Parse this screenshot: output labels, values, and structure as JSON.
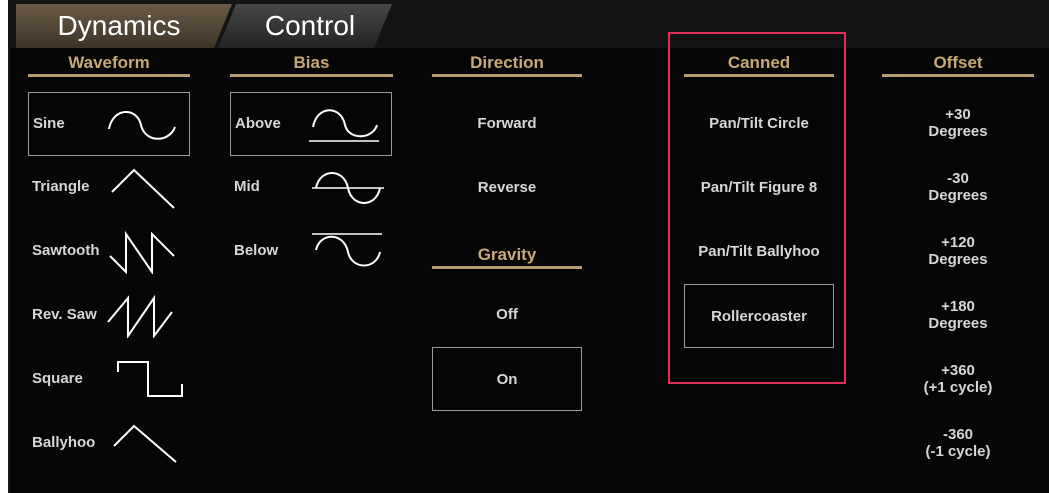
{
  "tabs": [
    {
      "label": "Dynamics",
      "active": true
    },
    {
      "label": "Control",
      "active": false
    }
  ],
  "columns": {
    "waveform": "Waveform",
    "bias": "Bias",
    "direction": "Direction",
    "gravity": "Gravity",
    "canned": "Canned",
    "offset": "Offset"
  },
  "waveform": {
    "items": [
      {
        "label": "Sine",
        "icon": "sine-wave-icon",
        "selected": true
      },
      {
        "label": "Triangle",
        "icon": "triangle-wave-icon",
        "selected": false
      },
      {
        "label": "Sawtooth",
        "icon": "sawtooth-wave-icon",
        "selected": false
      },
      {
        "label": "Rev. Saw",
        "icon": "reverse-saw-wave-icon",
        "selected": false
      },
      {
        "label": "Square",
        "icon": "square-wave-icon",
        "selected": false
      },
      {
        "label": "Ballyhoo",
        "icon": "ballyhoo-wave-icon",
        "selected": false
      }
    ]
  },
  "bias": {
    "items": [
      {
        "label": "Above",
        "icon": "bias-above-icon",
        "selected": true
      },
      {
        "label": "Mid",
        "icon": "bias-mid-icon",
        "selected": false
      },
      {
        "label": "Below",
        "icon": "bias-below-icon",
        "selected": false
      }
    ]
  },
  "direction": {
    "items": [
      {
        "label": "Forward",
        "selected": false
      },
      {
        "label": "Reverse",
        "selected": false
      }
    ]
  },
  "gravity": {
    "items": [
      {
        "label": "Off",
        "selected": false
      },
      {
        "label": "On",
        "selected": true
      }
    ]
  },
  "canned": {
    "items": [
      {
        "label": "Pan/Tilt Circle",
        "selected": false
      },
      {
        "label": "Pan/Tilt Figure 8",
        "selected": false
      },
      {
        "label": "Pan/Tilt Ballyhoo",
        "selected": false
      },
      {
        "label": "Rollercoaster",
        "selected": true
      }
    ]
  },
  "offset": {
    "items": [
      {
        "line1": "+30",
        "line2": "Degrees"
      },
      {
        "line1": "-30",
        "line2": "Degrees"
      },
      {
        "line1": "+120",
        "line2": "Degrees"
      },
      {
        "line1": "+180",
        "line2": "Degrees"
      },
      {
        "line1": "+360",
        "line2": "(+1 cycle)"
      },
      {
        "line1": "-360",
        "line2": "(-1 cycle)"
      }
    ]
  },
  "colors": {
    "background": "#060606",
    "header_text": "#c9a878",
    "header_rule": "#b79b73",
    "item_text": "#d6d6d6",
    "highlight": "#e0305a"
  }
}
